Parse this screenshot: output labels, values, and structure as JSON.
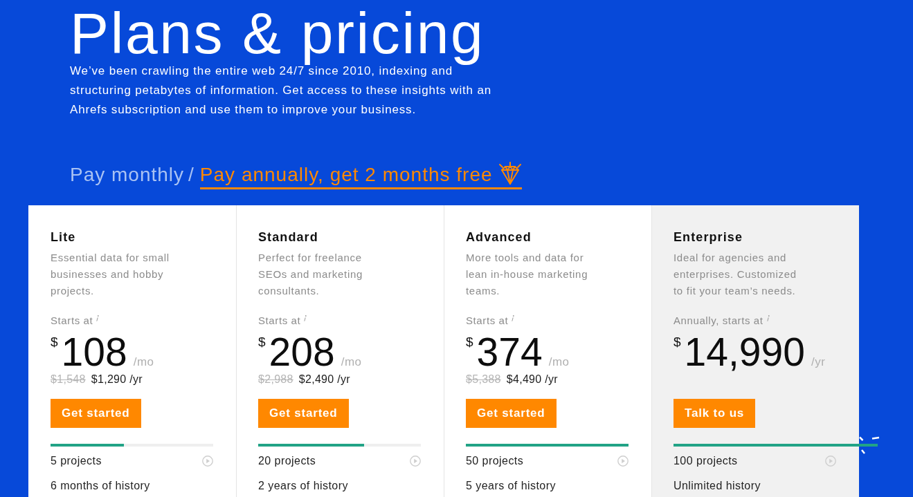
{
  "hero": {
    "title": "Plans & pricing",
    "intro": "We’ve been crawling the entire web 24/7 since 2010, indexing and structuring petabytes of information. Get access to these insights with an Ahrefs subscription and use them to improve your business."
  },
  "billing_toggle": {
    "options": [
      {
        "label": "Pay monthly",
        "selected": false,
        "gem_icon": false
      },
      {
        "label": "Pay annually, get 2 months free",
        "selected": true,
        "gem_icon": true
      }
    ],
    "separator": "/"
  },
  "plans": [
    {
      "name": "Lite",
      "description": "Essential data for small businesses and hobby projects.",
      "price_label": "Starts at",
      "currency": "$",
      "amount": "108",
      "period": "/mo",
      "old_price": "$1,548",
      "annual_price": "$1,290 /yr",
      "button": "Get started",
      "shaded": false,
      "meter": {
        "level": 0.45,
        "overflow": false
      },
      "features": [
        {
          "text": "5 projects",
          "video": true
        },
        {
          "text": "6 months of history",
          "video": false
        }
      ]
    },
    {
      "name": "Standard",
      "description": "Perfect for freelance SEOs and marketing consultants.",
      "price_label": "Starts at",
      "currency": "$",
      "amount": "208",
      "period": "/mo",
      "old_price": "$2,988",
      "annual_price": "$2,490 /yr",
      "button": "Get started",
      "shaded": false,
      "meter": {
        "level": 0.65,
        "overflow": false
      },
      "features": [
        {
          "text": "20 projects",
          "video": true
        },
        {
          "text": "2 years of history",
          "video": false
        }
      ]
    },
    {
      "name": "Advanced",
      "description": "More tools and data for lean in-house marketing teams.",
      "price_label": "Starts at",
      "currency": "$",
      "amount": "374",
      "period": "/mo",
      "old_price": "$5,388",
      "annual_price": "$4,490 /yr",
      "button": "Get started",
      "shaded": false,
      "meter": {
        "level": 1,
        "overflow": false
      },
      "features": [
        {
          "text": "50 projects",
          "video": true
        },
        {
          "text": "5 years of history",
          "video": false
        }
      ]
    },
    {
      "name": "Enterprise",
      "description": "Ideal for agencies and enterprises. Customized to fit your team’s needs.",
      "price_label": "Annually, starts at",
      "currency": "$",
      "amount": "14,990",
      "period": "/yr",
      "button": "Talk to us",
      "shaded": true,
      "meter": {
        "level": 1,
        "overflow": true
      },
      "features": [
        {
          "text": "100 projects",
          "video": true
        },
        {
          "text": "Unlimited history",
          "video": false
        }
      ]
    }
  ]
}
